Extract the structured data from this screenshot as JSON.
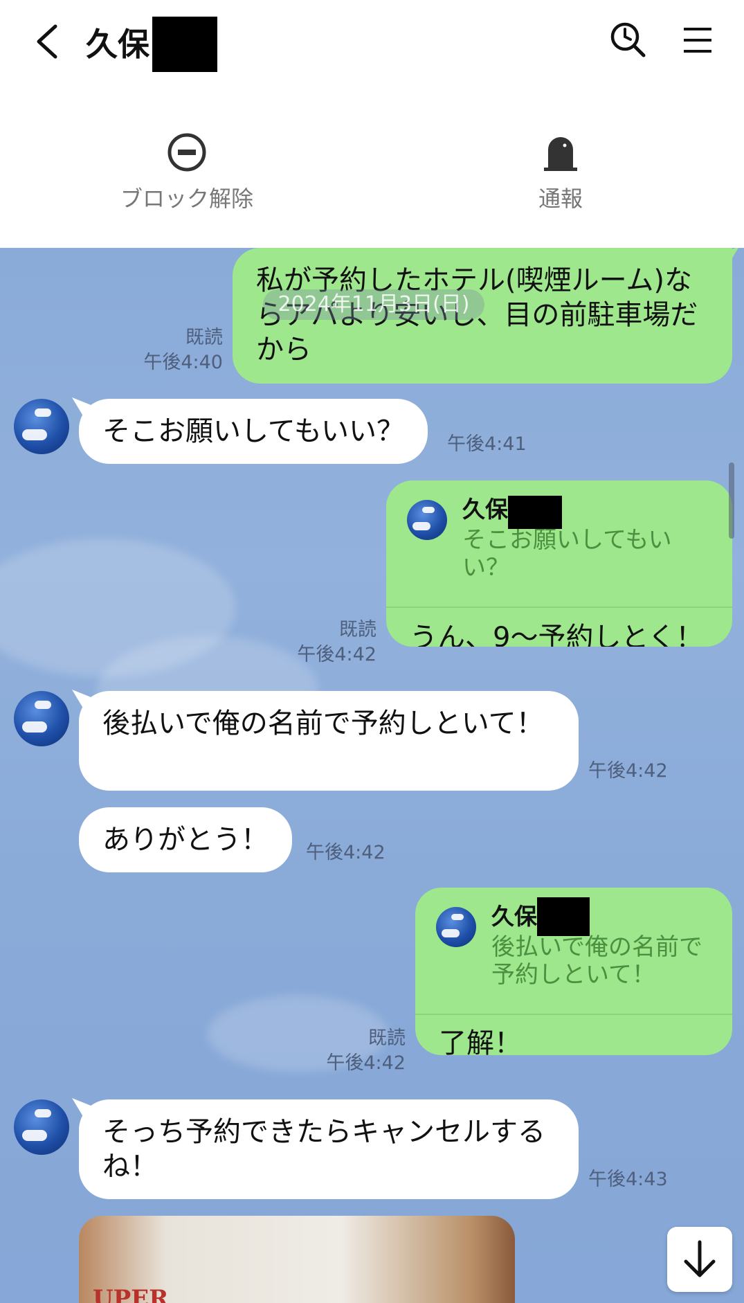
{
  "header": {
    "title": "久保",
    "back_icon": "chevron-left-icon",
    "search_icon": "search-icon",
    "menu_icon": "menu-icon"
  },
  "actions": [
    {
      "label": "ブロック解除",
      "icon": "unblock-icon"
    },
    {
      "label": "通報",
      "icon": "report-icon"
    }
  ],
  "chat": {
    "date_chip": "2024年11月3日(日)",
    "messages": [
      {
        "side": "out",
        "text": "私が予約したホテル(喫煙ルーム)ならアパより安いし、目の前駐車場だから",
        "read": "既読",
        "time": "午後4:40"
      },
      {
        "side": "in",
        "text": "そこお願いしてもいい？",
        "time": "午後4:41"
      },
      {
        "side": "out",
        "quote_name": "久保",
        "quote_text": "そこお願いしてもいい？",
        "text": "うん、9〜予約しとく！",
        "read": "既読",
        "time": "午後4:42"
      },
      {
        "side": "in",
        "text": "後払いで俺の名前で予約しといて！",
        "time": "午後4:42"
      },
      {
        "side": "in",
        "text": "ありがとう！",
        "time": "午後4:42"
      },
      {
        "side": "out",
        "quote_name": "久保",
        "quote_text": "後払いで俺の名前で予約しといて！",
        "text": "了解！",
        "read": "既読",
        "time": "午後4:42"
      },
      {
        "side": "in",
        "text": "そっち予約できたらキャンセルするね！",
        "time": "午後4:43"
      }
    ],
    "photo_text": "UPER",
    "scroll_down_icon": "arrow-down-icon"
  }
}
